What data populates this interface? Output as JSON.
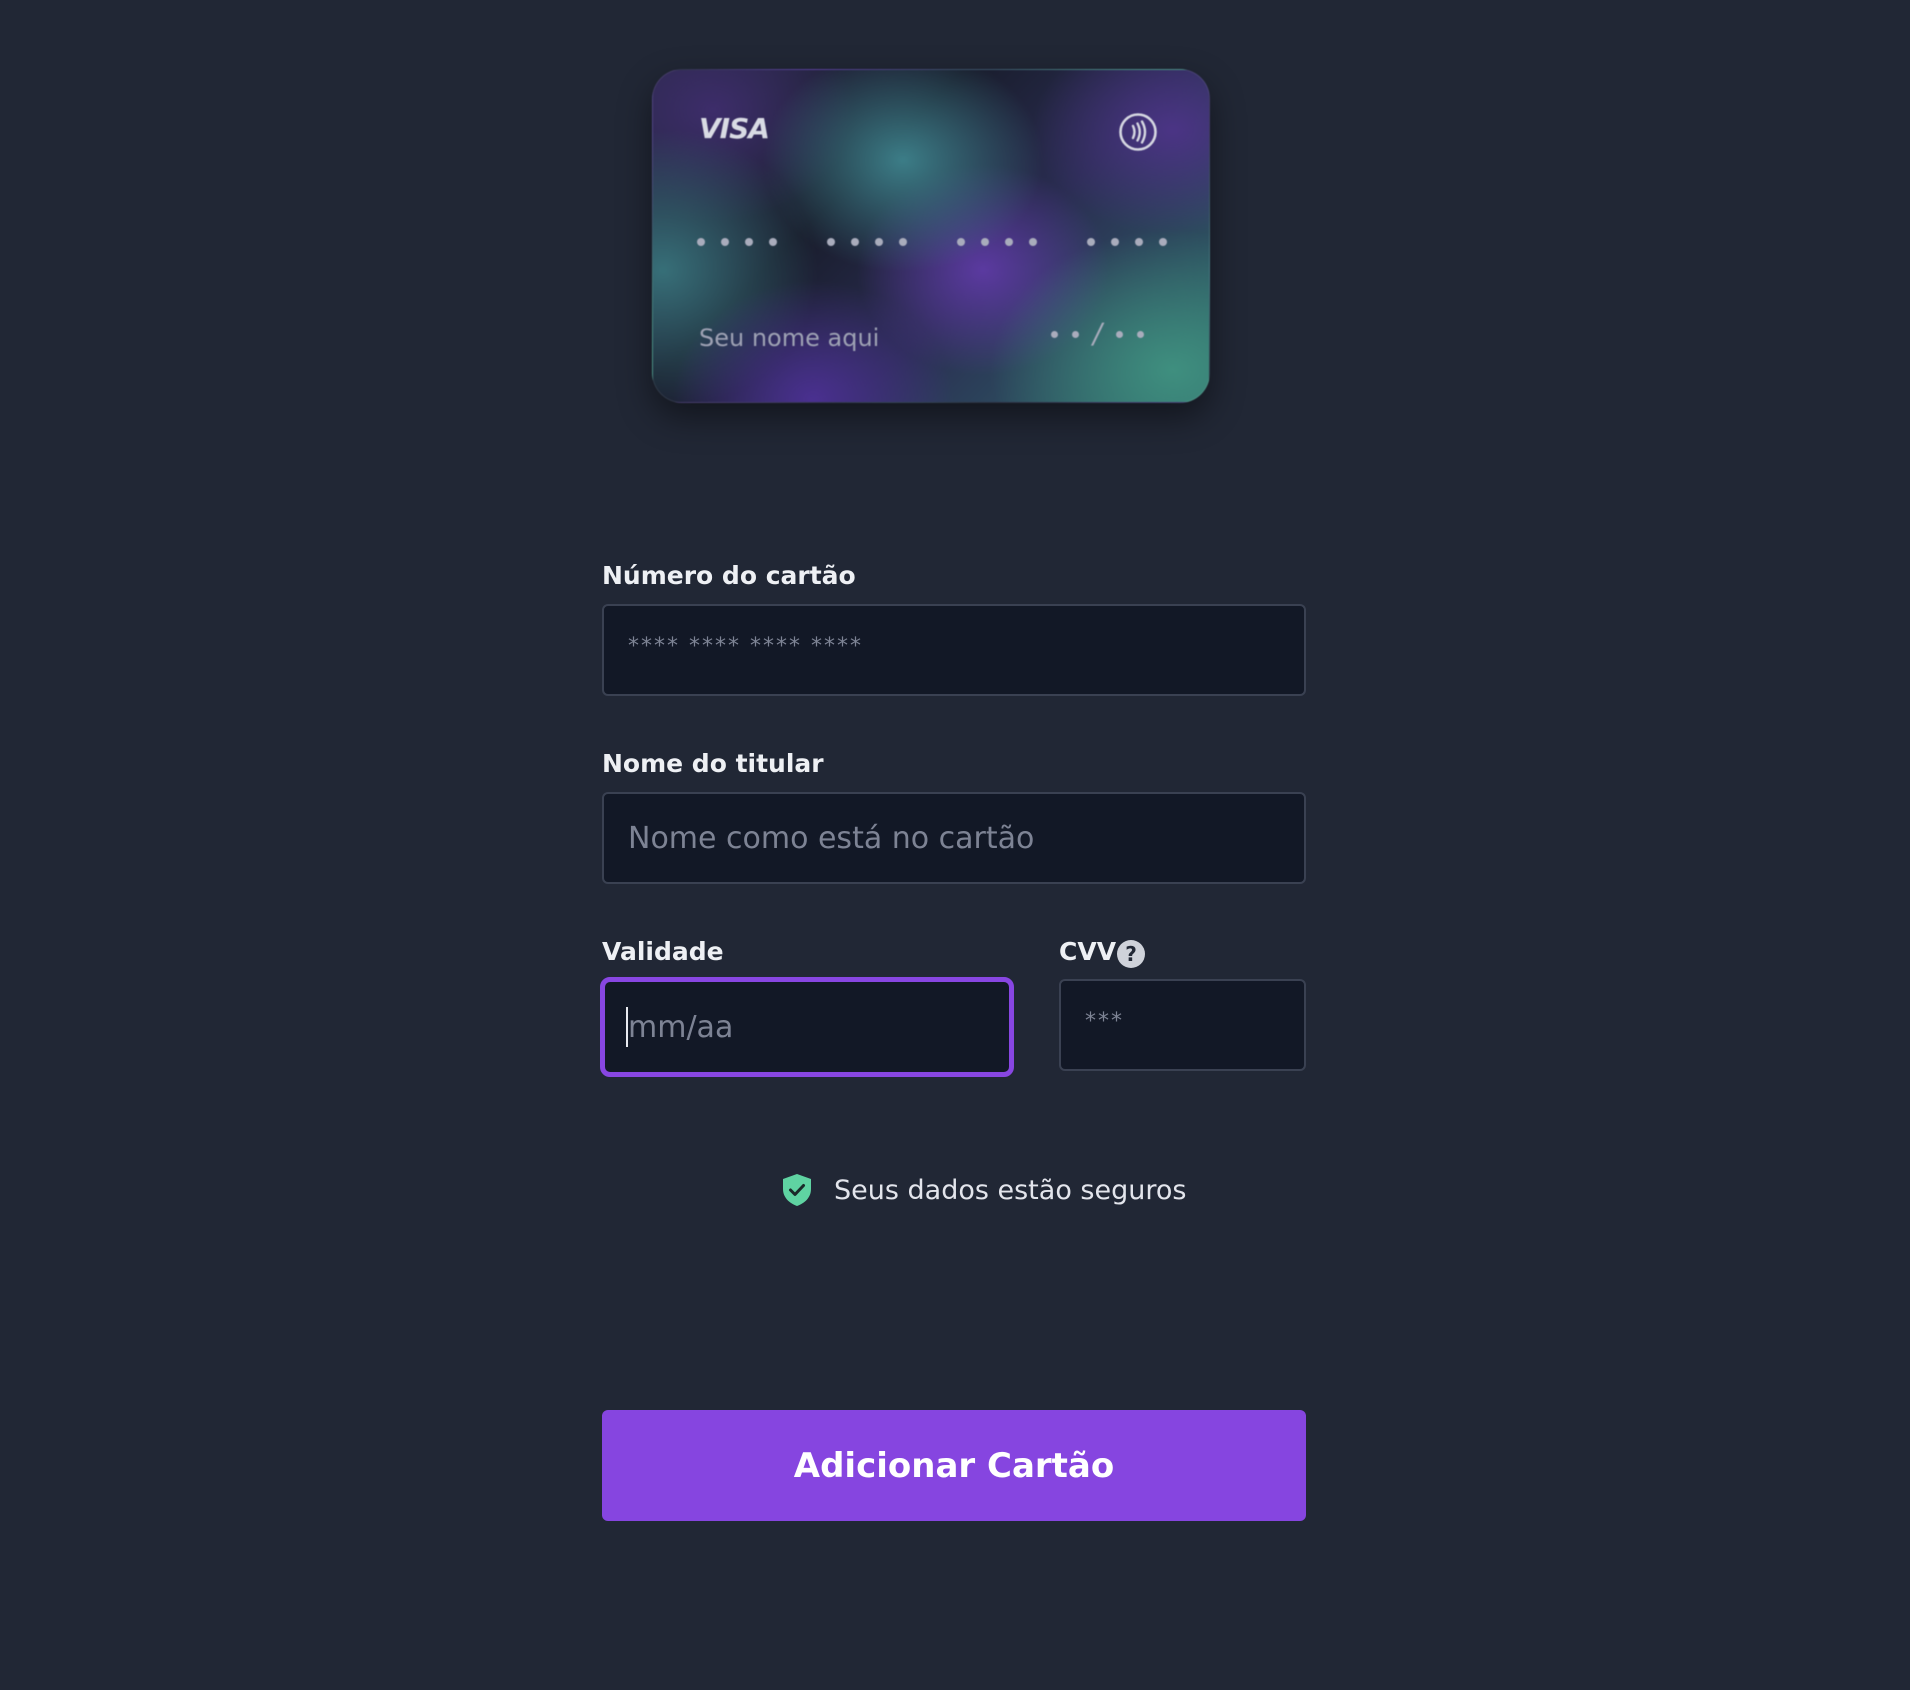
{
  "card_preview": {
    "brand": "VISA",
    "holder_placeholder": "Seu nome aqui",
    "expiry_separator": "/",
    "icons": {
      "contactless": "contactless-icon"
    }
  },
  "form": {
    "card_number": {
      "label": "Número do cartão",
      "placeholder": "**** **** **** ****"
    },
    "holder_name": {
      "label": "Nome do titular",
      "placeholder": "Nome como está no cartão"
    },
    "expiry": {
      "label": "Validade",
      "placeholder": "mm/aa"
    },
    "cvv": {
      "label": "CVV",
      "placeholder": "***",
      "help_icon": "help-icon",
      "help_glyph": "?"
    }
  },
  "security": {
    "text": "Seus dados estão seguros",
    "icon": "shield-check-icon"
  },
  "submit": {
    "label": "Adicionar Cartão"
  },
  "colors": {
    "background": "#212735",
    "input_background": "#121826",
    "accent": "#8645e0",
    "focus_border": "#8846e2",
    "secure_green": "#5fd3a2"
  }
}
